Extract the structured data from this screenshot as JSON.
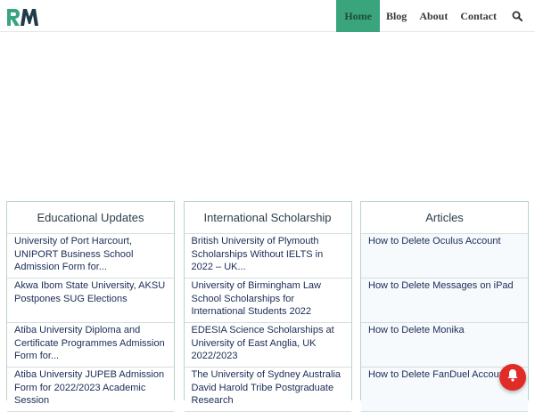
{
  "nav": {
    "items": [
      {
        "label": "Home",
        "active": true
      },
      {
        "label": "Blog",
        "active": false
      },
      {
        "label": "About",
        "active": false
      },
      {
        "label": "Contact",
        "active": false
      }
    ],
    "search_icon": "search-icon"
  },
  "logo": {
    "text": "RM"
  },
  "columns": [
    {
      "title": "Educational Updates",
      "items": [
        "University of Port Harcourt, UNIPORT Business School Admission Form for...",
        "Akwa Ibom State University, AKSU Postpones SUG Elections",
        "Atiba University Diploma and Certificate Programmes Admission Form for...",
        "Atiba University JUPEB Admission Form for 2022/2023 Academic Session"
      ]
    },
    {
      "title": "International Scholarship",
      "items": [
        "British University of Plymouth Scholarships Without IELTS in 2022 – UK...",
        "University of Birmingham Law School Scholarships for International Students 2022",
        "EDESIA Science Scholarships at University of East Anglia, UK 2022/2023",
        "The University of Sydney Australia David Harold Tribe Postgraduate Research"
      ]
    },
    {
      "title": "Articles",
      "items": [
        "How to Delete Oculus Account",
        "How to Delete Messages on iPad",
        "How to Delete Monika",
        "How to Delete FanDuel Account"
      ]
    }
  ],
  "notification": {
    "icon": "bell-icon"
  },
  "colors": {
    "accent": "#3aa57d",
    "bell": "#e02b27"
  }
}
